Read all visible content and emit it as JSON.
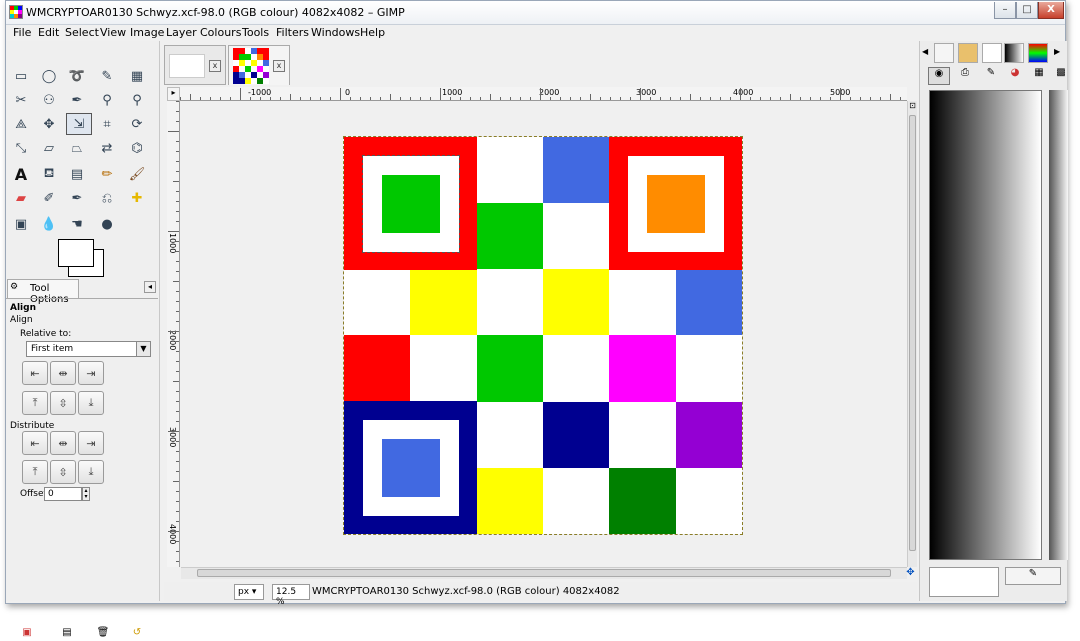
{
  "window": {
    "title": "WMCRYPTOAR0130 Schwyz.xcf-98.0 (RGB colour) 4082x4082 – GIMP",
    "min_label": "–",
    "max_label": "□",
    "close_label": "X"
  },
  "menu": [
    "File",
    "Edit",
    "Select",
    "View",
    "Image",
    "Layer",
    "Colours",
    "Tools",
    "Filters",
    "Windows",
    "Help"
  ],
  "tool_options": {
    "tab_label": "Tool Options",
    "heading": "Align",
    "subheading": "Align",
    "relative_to_label": "Relative to:",
    "relative_to_value": "First item",
    "distribute_label": "Distribute",
    "offset_label": "Offset:",
    "offset_value": "0"
  },
  "ruler": {
    "h_labels": [
      "-1000",
      "0",
      "1000",
      "2000",
      "3000",
      "4000",
      "5000"
    ],
    "v_labels": [
      "1000",
      "2000",
      "3000",
      "4000"
    ]
  },
  "status": {
    "unit": "px",
    "zoom": "12.5 %",
    "text": "WMCRYPTOAR0130 Schwyz.xcf-98.0 (RGB colour) 4082x4082"
  },
  "image_grid": [
    [
      "#ff0000",
      "#ff0000",
      "#ffffff",
      "#4169e1",
      "#ff0000",
      "#ff0000"
    ],
    [
      "#ff0000",
      "#ff0000",
      "#00c800",
      "#ffffff",
      "#ff0000",
      "#ff0000"
    ],
    [
      "#ffffff",
      "#ffff00",
      "#ffffff",
      "#ffff00",
      "#ffffff",
      "#4169e1"
    ],
    [
      "#ff0000",
      "#ffffff",
      "#00c800",
      "#ffffff",
      "#ff00ff",
      "#ffffff"
    ],
    [
      "#000090",
      "#000090",
      "#ffffff",
      "#000090",
      "#ffffff",
      "#9400d3"
    ],
    [
      "#000090",
      "#000090",
      "#ffff00",
      "#ffffff",
      "#008000",
      "#ffffff"
    ]
  ],
  "corner_squares": {
    "top_left": {
      "frame": "#ff0000",
      "center": "#00c800"
    },
    "top_right": {
      "frame": "#ff0000",
      "center": "#ff8c00"
    },
    "bottom_left": {
      "frame": "#000090",
      "center": "#4169e1"
    }
  },
  "colors": {
    "accent": "#dfe6ef"
  }
}
